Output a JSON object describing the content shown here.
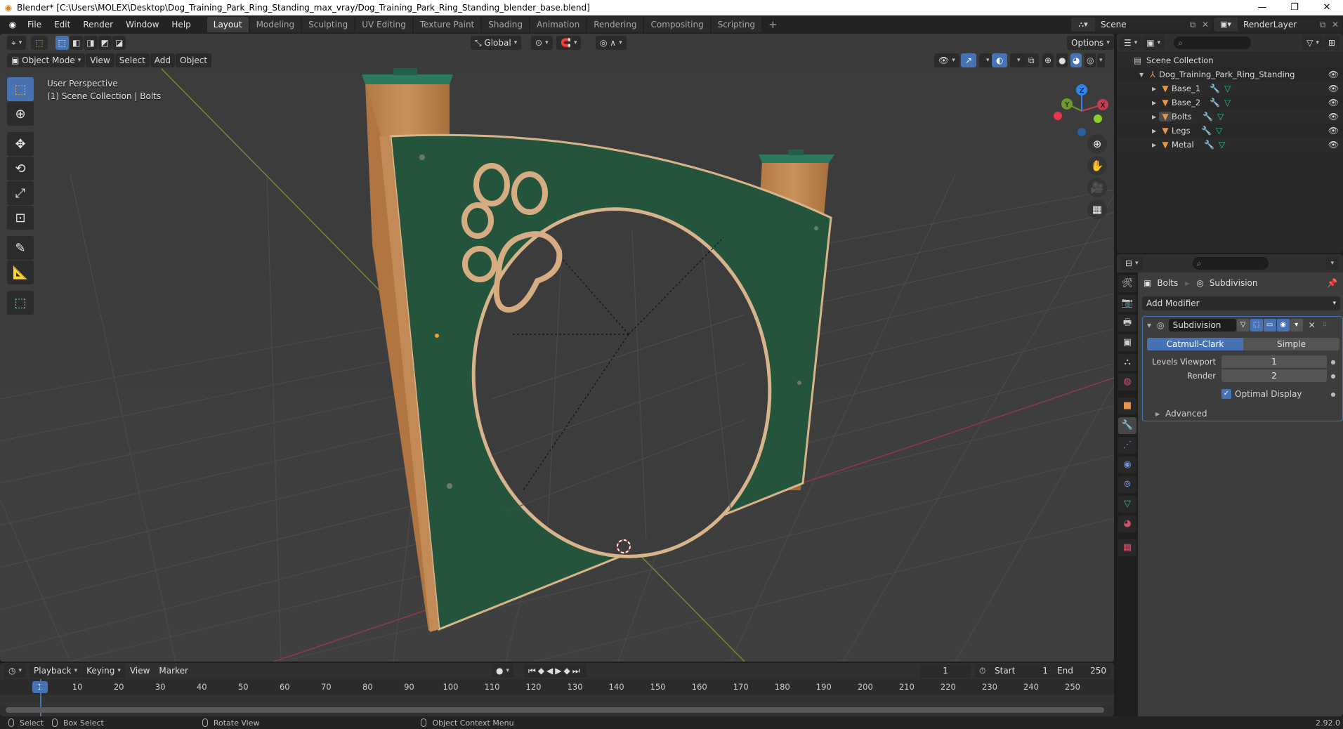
{
  "window": {
    "title": "Blender* [C:\\Users\\MOLEX\\Desktop\\Dog_Training_Park_Ring_Standing_max_vray/Dog_Training_Park_Ring_Standing_blender_base.blend]",
    "minimize": "—",
    "maximize": "❐",
    "close": "✕"
  },
  "menu": {
    "items": [
      "File",
      "Edit",
      "Render",
      "Window",
      "Help"
    ]
  },
  "workspaces": {
    "tabs": [
      "Layout",
      "Modeling",
      "Sculpting",
      "UV Editing",
      "Texture Paint",
      "Shading",
      "Animation",
      "Rendering",
      "Compositing",
      "Scripting"
    ],
    "active": "Layout",
    "add": "+"
  },
  "scene": {
    "name": "Scene",
    "view_layer": "RenderLayer"
  },
  "viewport": {
    "transform_orientation": "Global",
    "options_label": "Options",
    "mode": "Object Mode",
    "menus": [
      "View",
      "Select",
      "Add",
      "Object"
    ],
    "info_line1": "User Perspective",
    "info_line2": "(1) Scene Collection | Bolts",
    "gizmo_axes": {
      "x": "X",
      "y": "Y",
      "z": "Z"
    },
    "colors": {
      "x_axis": "#e8364e",
      "y_axis": "#8ccf2a",
      "z_axis": "#2f86e8",
      "panel_green": "#25543d",
      "wood": "#c48a53"
    }
  },
  "outliner": {
    "root": "Scene Collection",
    "collection": "Dog_Training_Park_Ring_Standing",
    "objects": [
      {
        "name": "Base_1"
      },
      {
        "name": "Base_2"
      },
      {
        "name": "Bolts",
        "selected": true
      },
      {
        "name": "Legs"
      },
      {
        "name": "Metal"
      }
    ]
  },
  "properties": {
    "breadcrumb_object": "Bolts",
    "breadcrumb_modifier": "Subdivision",
    "add_modifier": "Add Modifier",
    "modifier": {
      "name": "Subdivision",
      "type_options": [
        "Catmull-Clark",
        "Simple"
      ],
      "type_selected": "Catmull-Clark",
      "levels_viewport_label": "Levels Viewport",
      "levels_viewport": "1",
      "render_label": "Render",
      "render": "2",
      "optimal_display_label": "Optimal Display",
      "optimal_display": true,
      "advanced_label": "Advanced"
    }
  },
  "timeline": {
    "menus": [
      "Playback",
      "Keying",
      "View",
      "Marker"
    ],
    "current_frame": "1",
    "start_label": "Start",
    "start": "1",
    "end_label": "End",
    "end": "250",
    "ticks": [
      "10",
      "20",
      "30",
      "40",
      "50",
      "60",
      "70",
      "80",
      "90",
      "100",
      "110",
      "120",
      "130",
      "140",
      "150",
      "160",
      "170",
      "180",
      "190",
      "200",
      "210",
      "220",
      "230",
      "240",
      "250"
    ]
  },
  "status": {
    "select": "Select",
    "box_select": "Box Select",
    "rotate_view": "Rotate View",
    "context_menu": "Object Context Menu",
    "version": "2.92.0"
  }
}
